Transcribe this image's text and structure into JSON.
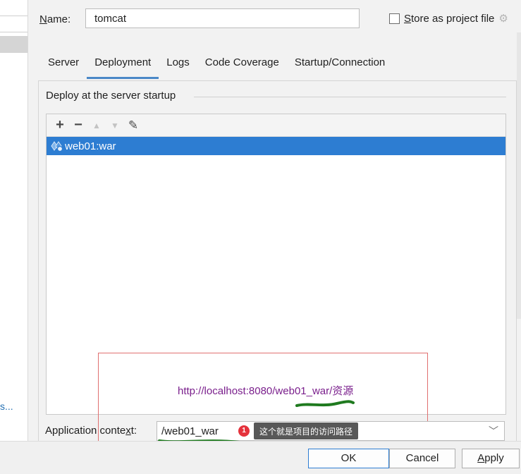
{
  "left_panel": {
    "link_text": "s..."
  },
  "header": {
    "name_label_mnemonic": "N",
    "name_label_rest": "ame:",
    "name_value": "tomcat",
    "store_label_mnemonic": "S",
    "store_label_rest": "tore as project file",
    "store_checked": false,
    "gear_icon": "gear-icon"
  },
  "tabs": [
    {
      "label": "Server",
      "active": false
    },
    {
      "label": "Deployment",
      "active": true
    },
    {
      "label": "Logs",
      "active": false
    },
    {
      "label": "Code Coverage",
      "active": false
    },
    {
      "label": "Startup/Connection",
      "active": false
    }
  ],
  "deploy": {
    "group_title": "Deploy at the server startup",
    "toolbar": {
      "add": "+",
      "remove": "−",
      "up": "▲",
      "down": "▼",
      "edit": "✎"
    },
    "items": [
      {
        "label": "web01:war",
        "selected": true
      }
    ]
  },
  "annotation": {
    "url": "http://localhost:8080/web01_war/资源",
    "badge": "1",
    "tooltip": "这个就是项目的访问路径"
  },
  "context": {
    "label_before": "Application conte",
    "label_mnemonic": "x",
    "label_after": "t:",
    "value": "/web01_war",
    "chevron": "﹀"
  },
  "buttons": {
    "ok": "OK",
    "cancel": "Cancel",
    "apply_mnemonic": "A",
    "apply_rest": "pply"
  },
  "colors": {
    "selection": "#2d7dd2",
    "tab_underline": "#4a88c7",
    "annotation_box": "#e07070",
    "annotation_text": "#7a1f8c",
    "scribble": "#1f7a1f",
    "badge": "#e5323c"
  }
}
